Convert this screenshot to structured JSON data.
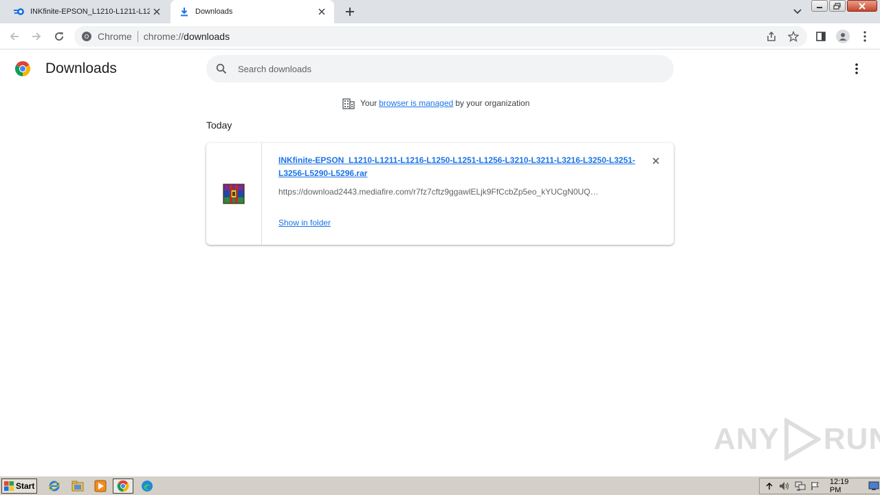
{
  "tabs": [
    {
      "title": "INKfinite-EPSON_L1210-L1211-L121…",
      "active": false
    },
    {
      "title": "Downloads",
      "active": true
    }
  ],
  "omnibox": {
    "site_label": "Chrome",
    "url_scheme": "chrome://",
    "url_path": "downloads"
  },
  "page": {
    "title": "Downloads",
    "search_placeholder": "Search downloads",
    "managed": {
      "prefix": "Your",
      "link": "browser is managed",
      "suffix": "by your organization"
    },
    "section": "Today"
  },
  "download": {
    "filename": "INKfinite-EPSON_L1210-L1211-L1216-L1250-L1251-L1256-L3210-L3211-L3216-L3250-L3251-L3256-L5290-L5296.rar",
    "url": "https://download2443.mediafire.com/r7fz7cftz9ggawlELjk9FfCcbZp5eo_kYUCgN0UQ…",
    "action": "Show in folder"
  },
  "watermark": {
    "left": "ANY",
    "right": "RUN"
  },
  "taskbar": {
    "start_label": "Start",
    "clock": "12:19 PM",
    "apps": [
      "ie-icon",
      "explorer-icon",
      "media-player-icon",
      "chrome-icon",
      "edge-icon"
    ]
  },
  "colors": {
    "link": "#1a73e8",
    "tabstrip": "#dee1e6",
    "taskbar": "#d4d0c8"
  }
}
